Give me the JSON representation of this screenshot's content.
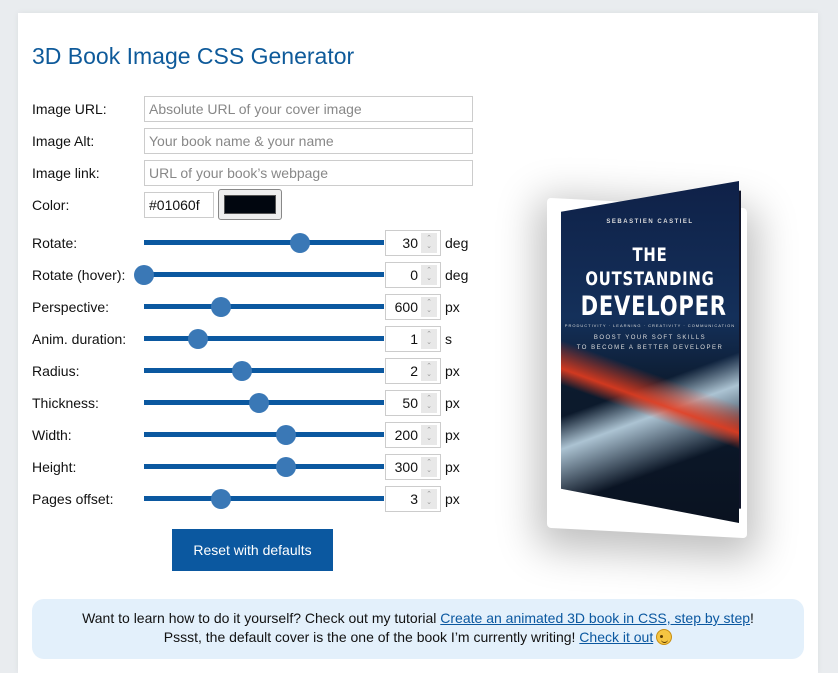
{
  "title": "3D Book Image CSS Generator",
  "fields": [
    {
      "label": "Image URL:",
      "value": "",
      "placeholder": "Absolute URL of your cover image"
    },
    {
      "label": "Image Alt:",
      "value": "",
      "placeholder": "Your book name & your name"
    },
    {
      "label": "Image link:",
      "value": "",
      "placeholder": "URL of your book’s webpage"
    }
  ],
  "color": {
    "label": "Color:",
    "value": "#01060f",
    "swatch": "#01060f"
  },
  "sliders": [
    {
      "label": "Rotate:",
      "value": "30",
      "unit": "deg",
      "position": 0.65
    },
    {
      "label": "Rotate (hover):",
      "value": "0",
      "unit": "deg",
      "position": 0.0
    },
    {
      "label": "Perspective:",
      "value": "600",
      "unit": "px",
      "position": 0.32
    },
    {
      "label": "Anim. duration:",
      "value": "1",
      "unit": "s",
      "position": 0.225
    },
    {
      "label": "Radius:",
      "value": "2",
      "unit": "px",
      "position": 0.41
    },
    {
      "label": "Thickness:",
      "value": "50",
      "unit": "px",
      "position": 0.48
    },
    {
      "label": "Width:",
      "value": "200",
      "unit": "px",
      "position": 0.59
    },
    {
      "label": "Height:",
      "value": "300",
      "unit": "px",
      "position": 0.59
    },
    {
      "label": "Pages offset:",
      "value": "3",
      "unit": "px",
      "position": 0.32
    }
  ],
  "reset_label": "Reset with defaults",
  "info": {
    "line1_text": "Want to learn how to do it yourself? Check out my tutorial ",
    "line1_link": "Create an animated 3D book in CSS, step by step",
    "line1_end": "!",
    "line2_text": "Pssst, the default cover is the one of the book I’m currently writing! ",
    "line2_link": "Check it out",
    "emoji": "winking-face"
  },
  "book": {
    "author": "SEBASTIEN CASTIEL",
    "title_line1": "THE OUTSTANDING",
    "title_line2": "DEVELOPER",
    "tags": "PRODUCTIVITY · LEARNING · CREATIVITY · COMMUNICATION",
    "subtitle_line1": "BOOST YOUR SOFT SKILLS",
    "subtitle_line2": "TO BECOME A BETTER DEVELOPER"
  },
  "colors": {
    "accent": "#0b58a0",
    "title": "#0e5a9a",
    "info_bg": "#e3f0fb"
  }
}
